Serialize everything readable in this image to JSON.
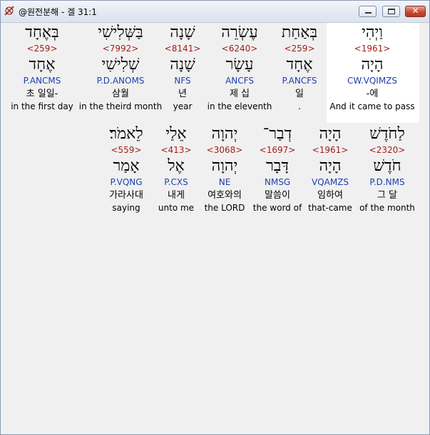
{
  "window": {
    "title": "@원전분해 - 겔 31:1",
    "buttons": {
      "minimize": "minimize",
      "maximize": "maximize",
      "close": "✕"
    },
    "icons": {
      "app": "app-icon",
      "minimize": "minimize-icon",
      "maximize": "maximize-icon",
      "close": "close-icon"
    }
  },
  "row1": [
    {
      "word": "בְּאֶחָד",
      "strong": "<259>",
      "lemma": "אֶחָד",
      "morph": "P.ANCMS",
      "korean": "초 일일-",
      "english": "in the first day"
    },
    {
      "word": "בַּשְּׁלִישִׁי",
      "strong": "<7992>",
      "lemma": "שְׁלִישִׁי",
      "morph": "P.D.ANOMS",
      "korean": "삼월",
      "english": "in the theird month"
    },
    {
      "word": "שָׁנָה",
      "strong": "<8141>",
      "lemma": "שָׁנָה",
      "morph": "NFS",
      "korean": "년",
      "english": "year"
    },
    {
      "word": "עֶשְׂרֵה",
      "strong": "<6240>",
      "lemma": "עָשָׂר",
      "morph": "ANCFS",
      "korean": "제 십",
      "english": "in the eleventh"
    },
    {
      "word": "בְּאַחַת",
      "strong": "<259>",
      "lemma": "אֶחָד",
      "morph": "P.ANCFS",
      "korean": "일",
      "english": "."
    },
    {
      "word": "וַיְהִי",
      "strong": "<1961>",
      "lemma": "הָיָה",
      "morph": "CW.VQIMZS",
      "korean": "-에",
      "english": "And it came to pass"
    }
  ],
  "row2": [
    {
      "word": "לֵאמֹר׃",
      "strong": "<559>",
      "lemma": "אָמַר",
      "morph": "P.VQNG",
      "korean": "가라사대",
      "english": "saying"
    },
    {
      "word": "אֵלַי",
      "strong": "<413>",
      "lemma": "אֶל",
      "morph": "P.CXS",
      "korean": "내게",
      "english": "unto me"
    },
    {
      "word": "יְהוָה",
      "strong": "<3068>",
      "lemma": "יְהוָה",
      "morph": "NE",
      "korean": "여호와의",
      "english": "the LORD"
    },
    {
      "word": "דְבַר־",
      "strong": "<1697>",
      "lemma": "דָּבָר",
      "morph": "NMSG",
      "korean": "말씀이",
      "english": "the word of"
    },
    {
      "word": "הָיָה",
      "strong": "<1961>",
      "lemma": "הָיָה",
      "morph": "VQAMZS",
      "korean": "임하여",
      "english": "that-came"
    },
    {
      "word": "לַחֹדֶשׁ",
      "strong": "<2320>",
      "lemma": "חֹדֶשׁ",
      "morph": "P.D.NMS",
      "korean": "그 달",
      "english": "of the month"
    }
  ]
}
